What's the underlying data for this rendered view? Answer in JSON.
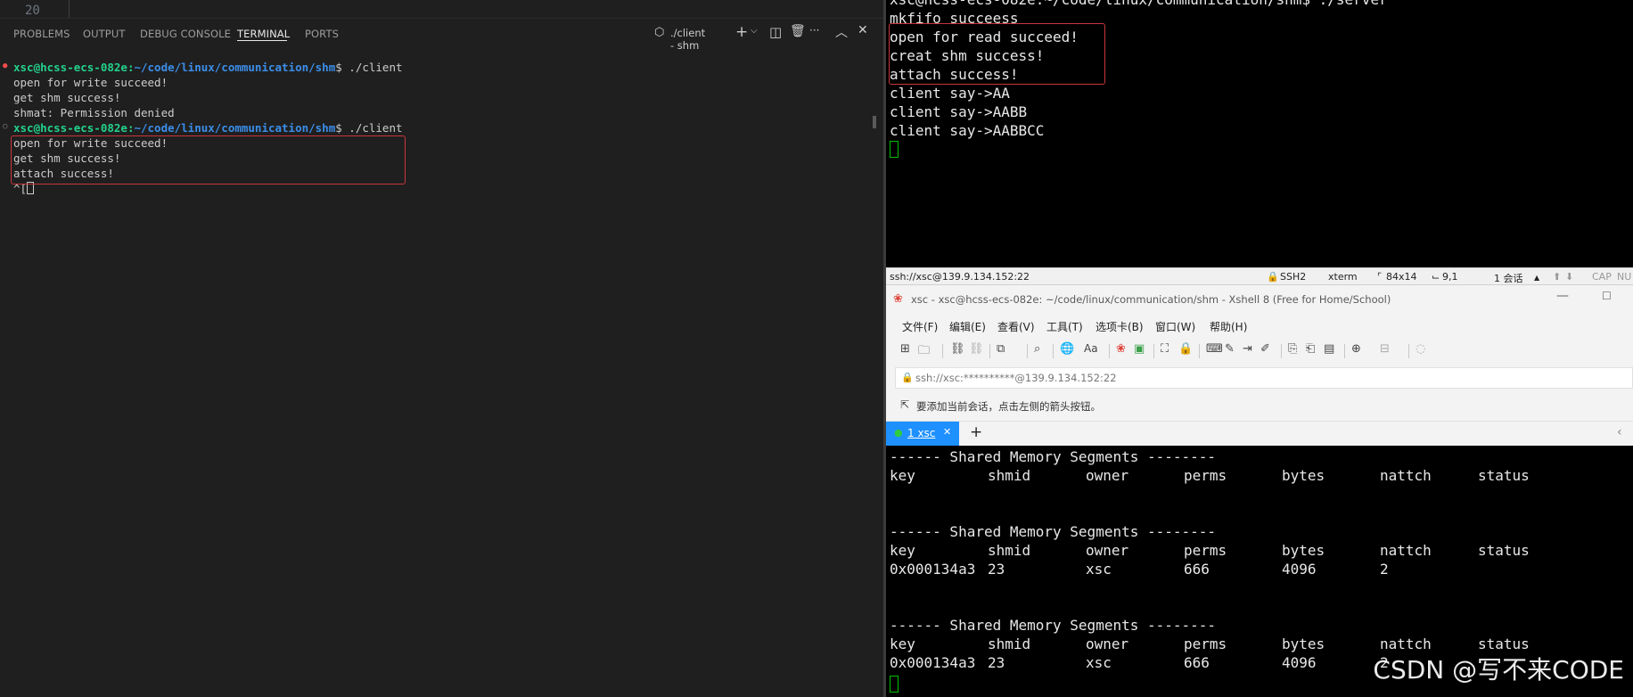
{
  "vscode": {
    "line_number": "20",
    "tabs": [
      "PROBLEMS",
      "OUTPUT",
      "DEBUG CONSOLE",
      "TERMINAL",
      "PORTS"
    ],
    "active_tab": "TERMINAL",
    "terminal_name": "./client - shm",
    "prompt_user": "xsc@hcss-ecs-082e",
    "prompt_sep": ":",
    "prompt_path": "~/code/linux/communication/shm",
    "prompt_tail": "$ ./client",
    "lines": [
      "open for write succeed!",
      "get shm success!",
      "shmat: Permission denied",
      "open for write succeed!",
      "get shm success!",
      "attach success!",
      "^["
    ]
  },
  "xshell1": {
    "partial_top": "xsc@hcss-ecs-082e:~/code/linux/communication/shm$ ./server",
    "lines": [
      "mkfifo succeess",
      "open for read succeed!",
      "creat shm success!",
      "attach success!",
      "client say->AA",
      "client say->AABB",
      "client say->AABBCC"
    ]
  },
  "status_bar": {
    "host": "ssh://xsc@139.9.134.152:22",
    "protocol": "SSH2",
    "term": "xterm",
    "size": "84x14",
    "pos": "9,1",
    "sessions": "1 会话",
    "caps": "CAP",
    "num": "NU"
  },
  "xshell2": {
    "title": "xsc - xsc@hcss-ecs-082e: ~/code/linux/communication/shm - Xshell 8 (Free for Home/School)",
    "menu": [
      "文件(F)",
      "编辑(E)",
      "查看(V)",
      "工具(T)",
      "选项卡(B)",
      "窗口(W)",
      "帮助(H)"
    ],
    "address": "ssh://xsc:**********@139.9.134.152:22",
    "hint": "要添加当前会话，点击左侧的箭头按钮。",
    "tab_label": "1 xsc",
    "segments_header": "------ Shared Memory Segments --------",
    "columns": [
      "key",
      "shmid",
      "owner",
      "perms",
      "bytes",
      "nattch",
      "status"
    ],
    "row": [
      "0x000134a3",
      "23",
      "xsc",
      "666",
      "4096",
      "2"
    ],
    "watermark": "CSDN @写不来CODE"
  }
}
